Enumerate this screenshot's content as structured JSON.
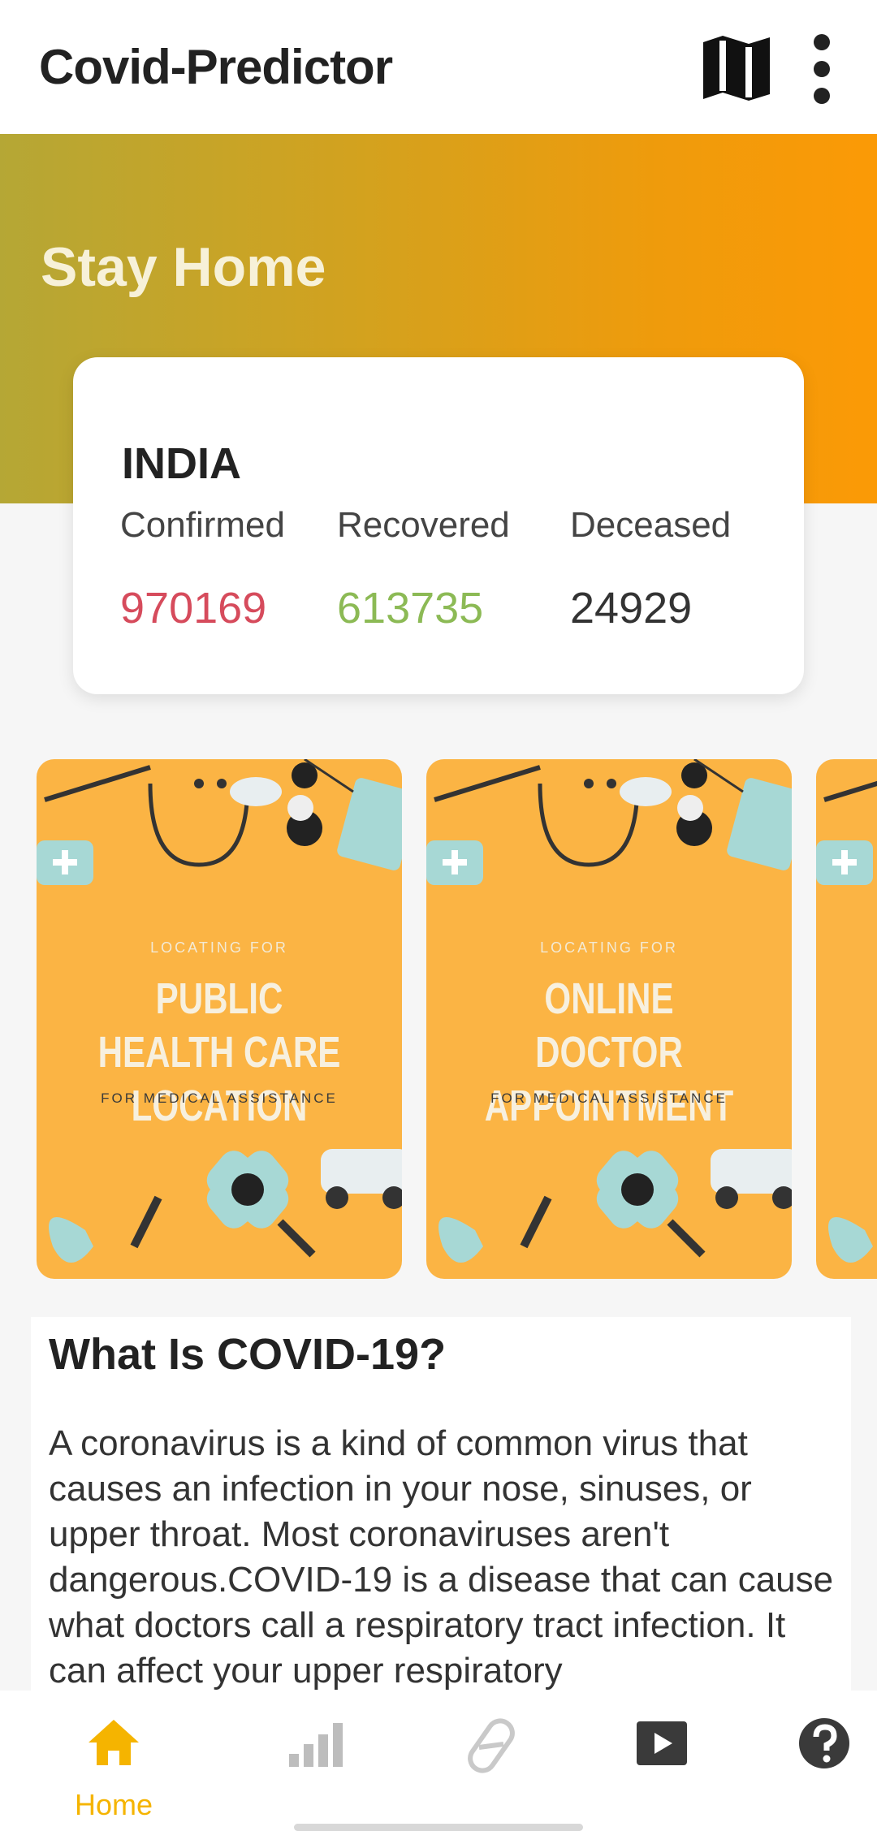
{
  "app": {
    "title": "Covid-Predictor"
  },
  "icons": {
    "map": "map-icon",
    "more": "more-vert-icon"
  },
  "hero": {
    "title": "Stay Home",
    "gradient_start": "#b5a735",
    "gradient_end": "#fb9a06"
  },
  "stats": {
    "country": "INDIA",
    "confirmed_label": "Confirmed",
    "recovered_label": "Recovered",
    "deceased_label": "Deceased",
    "confirmed": "970169",
    "recovered": "613735",
    "deceased": "24929",
    "colors": {
      "confirmed": "#d64b5c",
      "recovered": "#8cba55",
      "deceased": "#333333"
    }
  },
  "carousel": {
    "cards": [
      {
        "kicker": "LOCATING FOR",
        "title": "PUBLIC HEALTH CARE LOCATION",
        "sub": "FOR MEDICAL ASSISTANCE"
      },
      {
        "kicker": "LOCATING FOR",
        "title": "ONLINE DOCTOR APPOINTMENT",
        "sub": "FOR MEDICAL ASSISTANCE"
      }
    ],
    "card_color": "#fbb444"
  },
  "info": {
    "title": "What Is COVID-19?",
    "body": "A coronavirus is a kind of common virus that causes an infection in your nose, sinuses, or upper throat. Most coronaviruses aren't dangerous.COVID-19 is a disease that can cause what doctors call a respiratory tract infection. It can affect your upper respiratory"
  },
  "nav": {
    "items": [
      {
        "label": "Home",
        "icon": "home-icon",
        "active": true
      },
      {
        "label": "",
        "icon": "stats-icon",
        "active": false
      },
      {
        "label": "",
        "icon": "pill-icon",
        "active": false
      },
      {
        "label": "",
        "icon": "video-icon",
        "active": false
      },
      {
        "label": "",
        "icon": "help-icon",
        "active": false
      }
    ],
    "active_color": "#f5b400"
  }
}
